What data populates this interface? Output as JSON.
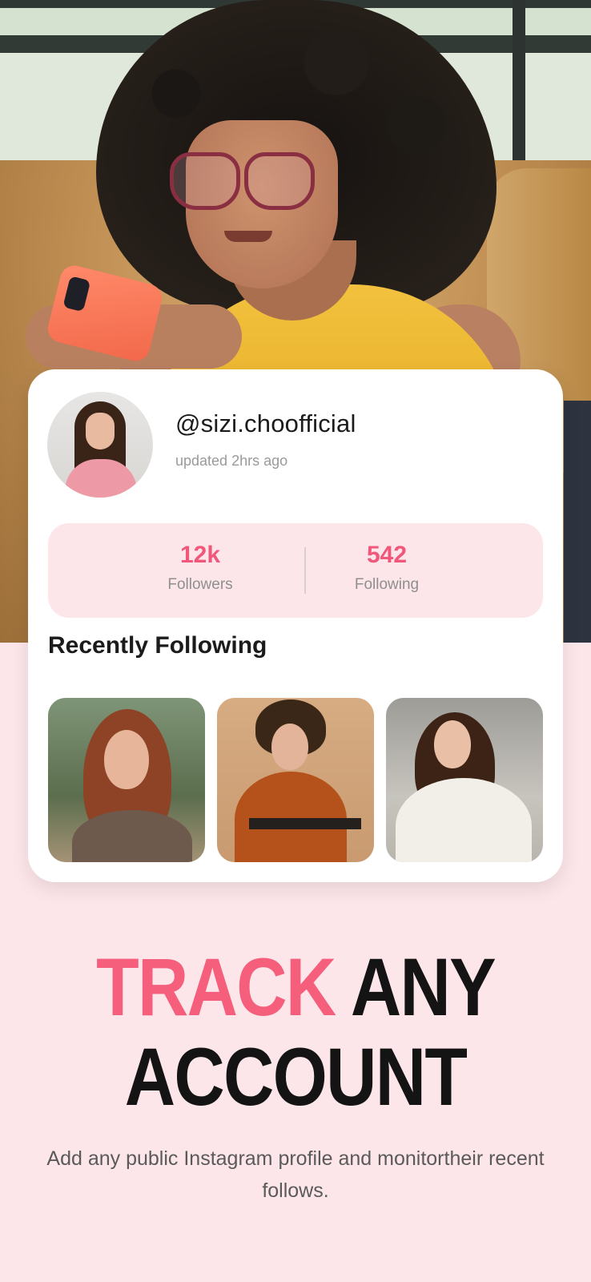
{
  "profile": {
    "username": "@sizi.choofficial",
    "updated": "updated 2hrs ago"
  },
  "stats": {
    "followers_value": "12k",
    "followers_label": "Followers",
    "following_value": "542",
    "following_label": "Following"
  },
  "recent": {
    "title": "Recently Following"
  },
  "headline": {
    "accent": "TRACK",
    "rest_line1": " ANY",
    "line2": "ACCOUNT"
  },
  "subtitle": "Add any public Instagram profile and monitortheir recent follows.",
  "colors": {
    "accent": "#f55f7c",
    "stat_number": "#f0577a",
    "background": "#fde6ea"
  }
}
